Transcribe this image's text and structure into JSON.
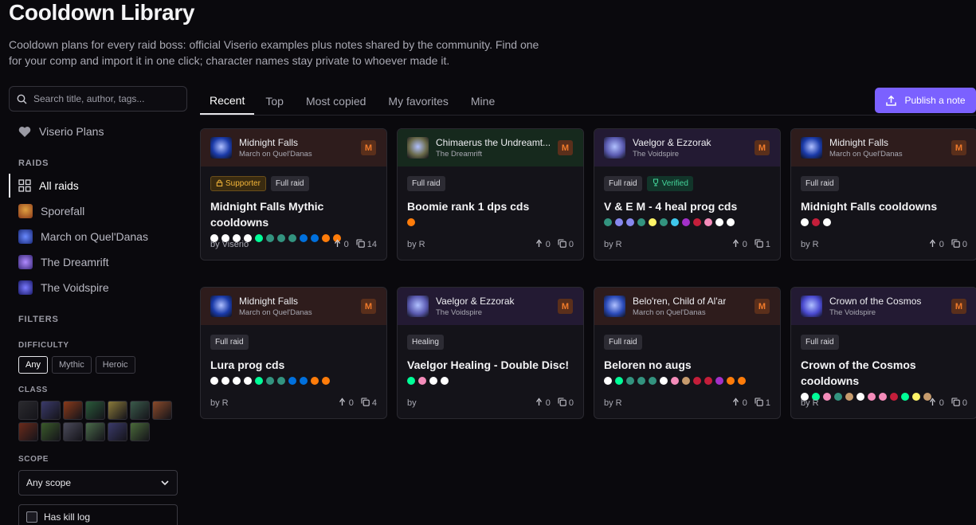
{
  "header": {
    "title": "Cooldown Library",
    "description": "Cooldown plans for every raid boss: official Viserio examples plus notes shared by the community. Find one for your comp and import it in one click; character names stay private to whoever made it."
  },
  "sidebar": {
    "search_placeholder": "Search title, author, tags...",
    "viserio_plans": "Viserio Plans",
    "raids_heading": "RAIDS",
    "raids": [
      {
        "label": "All raids",
        "icon": "grid-icon",
        "color": ""
      },
      {
        "label": "Sporefall",
        "icon": "sporefall-icon",
        "color": "#b8642a"
      },
      {
        "label": "March on Quel'Danas",
        "icon": "march-icon",
        "color": "#2a3ea8"
      },
      {
        "label": "The Dreamrift",
        "icon": "dreamrift-icon",
        "color": "#6a4ab8"
      },
      {
        "label": "The Voidspire",
        "icon": "voidspire-icon",
        "color": "#3a3ac0"
      }
    ],
    "filters_heading": "FILTERS",
    "difficulty_heading": "DIFFICULTY",
    "difficulties": [
      "Any",
      "Mythic",
      "Heroic"
    ],
    "class_heading": "CLASS",
    "class_colors": [
      "#2a2a2e",
      "#3a3a6a",
      "#8a3a1a",
      "#2a5a3a",
      "#8a7a3a",
      "#3a5a4a",
      "#8a4a2a",
      "#6a2a1a",
      "#3a5a2a",
      "#4a4a5a",
      "#4a6a4a",
      "#3a3a6a",
      "#4a6a3a"
    ],
    "scope_heading": "SCOPE",
    "scope_value": "Any scope",
    "kill_log_label": "Has kill log"
  },
  "tabs": [
    "Recent",
    "Top",
    "Most copied",
    "My favorites",
    "Mine"
  ],
  "publish_label": "Publish a note",
  "cards": [
    {
      "boss": "Midnight Falls",
      "raid": "March on Quel'Danas",
      "diff": "M",
      "head_color": "#2e1c1c",
      "ico_color": "#1a3aa8",
      "tags": [
        {
          "label": "Supporter",
          "kind": "supporter"
        },
        {
          "label": "Full raid",
          "kind": "plain"
        }
      ],
      "title": "Midnight Falls Mythic cooldowns",
      "dots": [
        "#ffffff",
        "#ffffff",
        "#ffffff",
        "#ffffff",
        "#00ff98",
        "#33937f",
        "#33937f",
        "#33937f",
        "#0070dd",
        "#0070dd",
        "#ff7c0a",
        "#ff7c0a"
      ],
      "author": "by Viserio",
      "up": "0",
      "copies": "14"
    },
    {
      "boss": "Chimaerus the Undreamt...",
      "raid": "The Dreamrift",
      "diff": "M",
      "head_color": "#16291d",
      "ico_color": "#6a6a4a",
      "tags": [
        {
          "label": "Full raid",
          "kind": "plain"
        }
      ],
      "title": "Boomie rank 1 dps cds",
      "dots": [
        "#ff7c0a"
      ],
      "author": "by R",
      "up": "0",
      "copies": "0"
    },
    {
      "boss": "Vaelgor & Ezzorak",
      "raid": "The Voidspire",
      "diff": "M",
      "head_color": "#231a33",
      "ico_color": "#5a5ab0",
      "tags": [
        {
          "label": "Full raid",
          "kind": "plain"
        },
        {
          "label": "Verified",
          "kind": "verified"
        }
      ],
      "title": "V & E M - 4 heal prog cds",
      "dots": [
        "#33937f",
        "#8788ee",
        "#8788ee",
        "#33937f",
        "#fff468",
        "#33937f",
        "#3fc7eb",
        "#a330c9",
        "#c41e3a",
        "#f48cba",
        "#ffffff",
        "#ffffff"
      ],
      "author": "by R",
      "up": "0",
      "copies": "1"
    },
    {
      "boss": "Midnight Falls",
      "raid": "March on Quel'Danas",
      "diff": "M",
      "head_color": "#2e1c1c",
      "ico_color": "#1a3aa8",
      "tags": [
        {
          "label": "Full raid",
          "kind": "plain"
        }
      ],
      "title": "Midnight Falls cooldowns",
      "dots": [
        "#ffffff",
        "#c41e3a",
        "#ffffff"
      ],
      "author": "by R",
      "up": "0",
      "copies": "0"
    },
    {
      "boss": "Midnight Falls",
      "raid": "March on Quel'Danas",
      "diff": "M",
      "head_color": "#2e1c1c",
      "ico_color": "#1a3aa8",
      "tags": [
        {
          "label": "Full raid",
          "kind": "plain"
        }
      ],
      "title": "Lura prog cds",
      "dots": [
        "#ffffff",
        "#ffffff",
        "#ffffff",
        "#ffffff",
        "#00ff98",
        "#33937f",
        "#33937f",
        "#0070dd",
        "#0070dd",
        "#ff7c0a",
        "#ff7c0a"
      ],
      "author": "by R",
      "up": "0",
      "copies": "4"
    },
    {
      "boss": "Vaelgor & Ezzorak",
      "raid": "The Voidspire",
      "diff": "M",
      "head_color": "#231a33",
      "ico_color": "#5a5ab0",
      "tags": [
        {
          "label": "Healing",
          "kind": "plain"
        }
      ],
      "title": "Vaelgor Healing - Double Disc!",
      "dots": [
        "#00ff98",
        "#f48cba",
        "#ffffff",
        "#ffffff"
      ],
      "author": "by",
      "up": "0",
      "copies": "0"
    },
    {
      "boss": "Belo'ren, Child of Al'ar",
      "raid": "March on Quel'Danas",
      "diff": "M",
      "head_color": "#2e1c1c",
      "ico_color": "#2a4ab8",
      "tags": [
        {
          "label": "Full raid",
          "kind": "plain"
        }
      ],
      "title": "Beloren no augs",
      "dots": [
        "#ffffff",
        "#00ff98",
        "#33937f",
        "#33937f",
        "#33937f",
        "#ffffff",
        "#f48cba",
        "#c69b6d",
        "#c41e3a",
        "#c41e3a",
        "#a330c9",
        "#ff7c0a",
        "#ff7c0a"
      ],
      "author": "by R",
      "up": "0",
      "copies": "1"
    },
    {
      "boss": "Crown of the Cosmos",
      "raid": "The Voidspire",
      "diff": "M",
      "head_color": "#231a33",
      "ico_color": "#4a4ad0",
      "tags": [
        {
          "label": "Full raid",
          "kind": "plain"
        }
      ],
      "title": "Crown of the Cosmos cooldowns",
      "dots": [
        "#ffffff",
        "#00ff98",
        "#f48cba",
        "#33937f",
        "#c69b6d",
        "#ffffff",
        "#f48cba",
        "#f48cba",
        "#c41e3a",
        "#00ff98",
        "#fff468",
        "#c69b6d"
      ],
      "author": "by R",
      "up": "0",
      "copies": "0"
    }
  ]
}
